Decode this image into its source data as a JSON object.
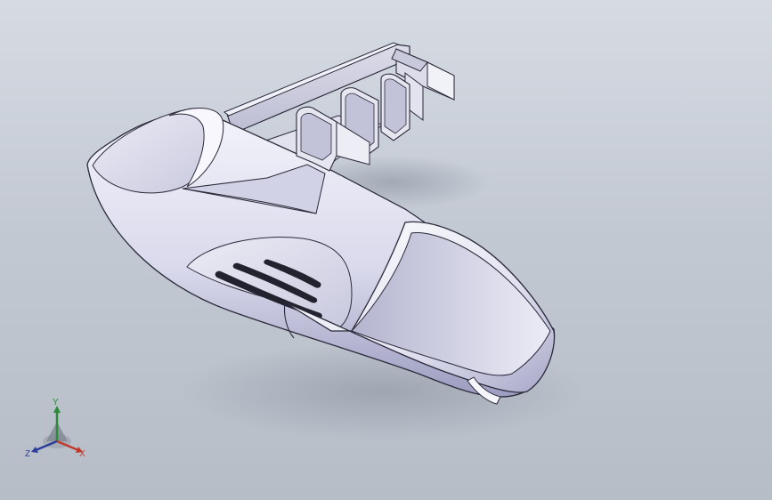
{
  "viewport": {
    "background_top": "#d6dbe3",
    "background_bottom": "#b7bdc7",
    "model_color": "#e6e6f4",
    "model_shadow_color": "#8e8fb0"
  },
  "triad": {
    "y_label": "Y",
    "x_label": "X",
    "z_label": "Z",
    "y_color": "#2d8a3a",
    "x_color": "#c0392b",
    "z_color": "#2c3e9a"
  }
}
